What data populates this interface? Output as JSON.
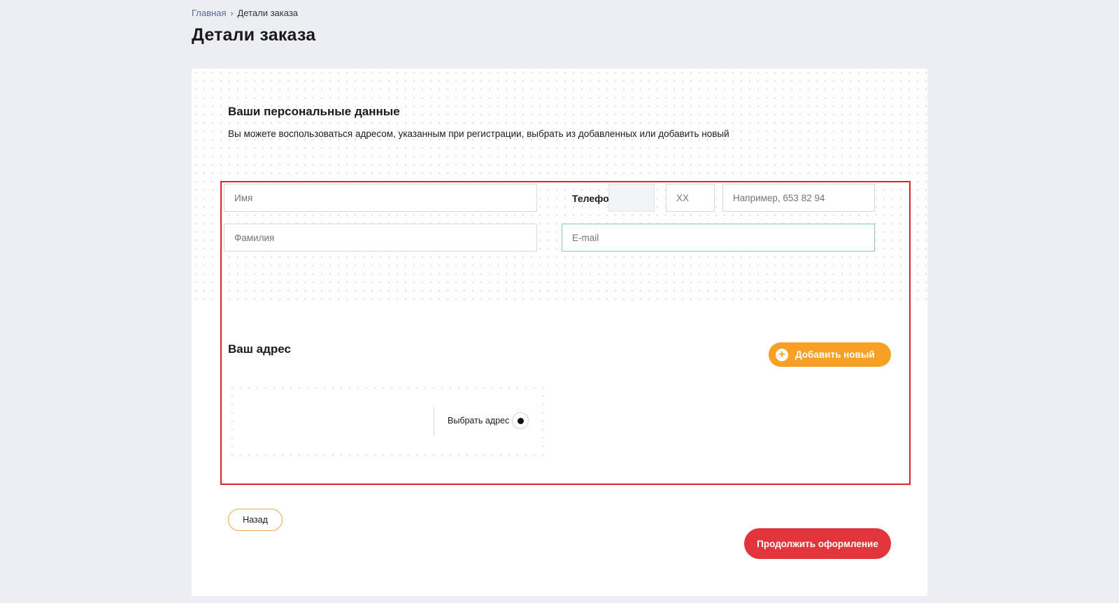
{
  "breadcrumb": {
    "home": "Главная",
    "separator": "›",
    "current": "Детали заказа"
  },
  "page_title": "Детали заказа",
  "personal": {
    "title": "Ваши персональные данные",
    "description": "Вы можете воспользоваться адресом, указанным при регистрации, выбрать из добавленных или добавить новый",
    "first_name_placeholder": "Имя",
    "last_name_placeholder": "Фамилия",
    "phone_label": "Телефон",
    "phone_code_value": "",
    "phone_operator_placeholder": "XX",
    "phone_number_placeholder": "Например, 653 82 94",
    "email_placeholder": "E-mail"
  },
  "address": {
    "title": "Ваш адрес",
    "add_button_label": "Добавить новый",
    "select_label": "Выбрать адрес",
    "selected": true
  },
  "actions": {
    "back_label": "Назад",
    "continue_label": "Продолжить оформление"
  },
  "colors": {
    "accent_orange": "#f7a025",
    "primary_red": "#e2353b",
    "highlight_border": "#e0202a",
    "background": "#eceef1"
  }
}
